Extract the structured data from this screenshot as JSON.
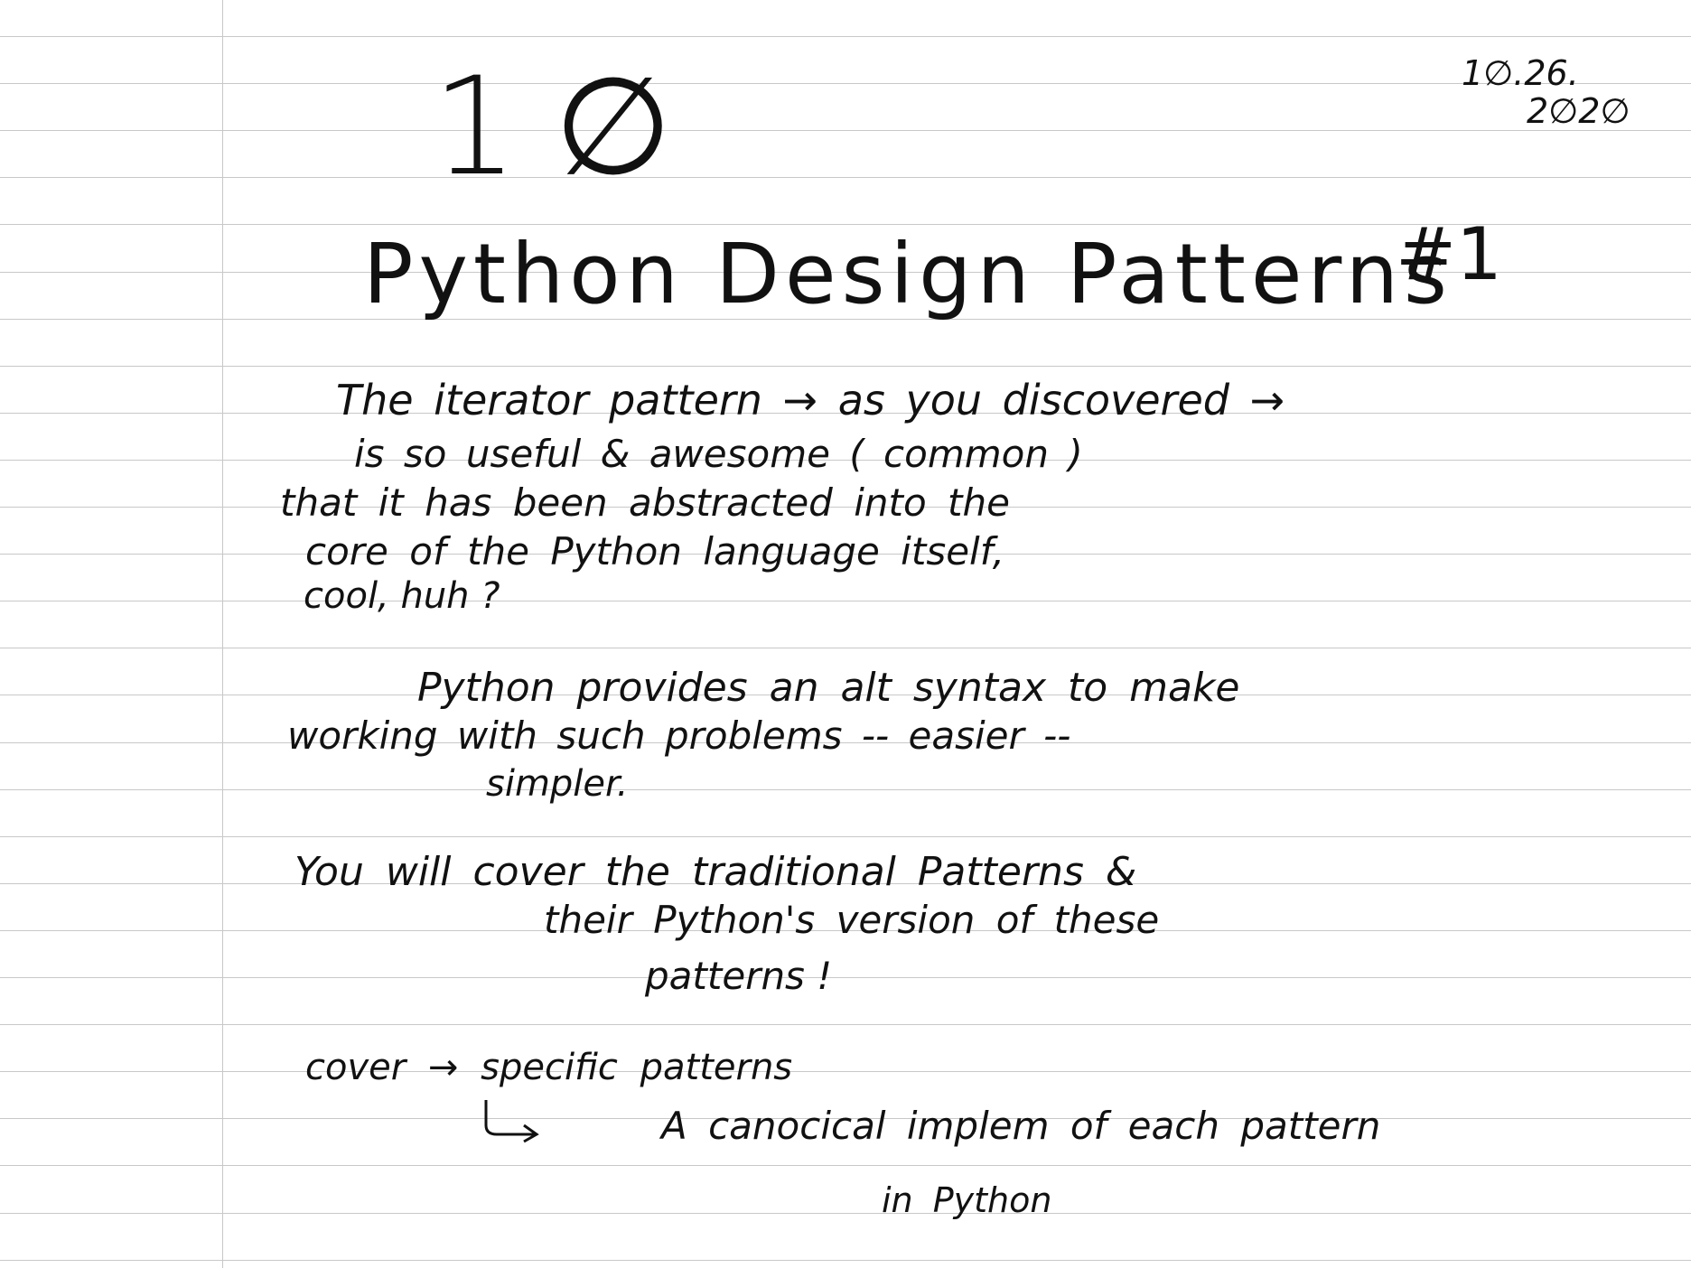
{
  "note": {
    "page_number": "1∅",
    "date_line1": "1∅.26.",
    "date_line2": "2∅2∅",
    "title": "Python Design Patterns",
    "title_badge": "#1",
    "lines": [
      "The   iterator pattern →   as you discovered →",
      "is  so   useful  &   awesome   ( common )",
      "that   it   has  been   abstracted    into   the",
      "core   of    the   Python  language   itself,",
      "cool, huh ?",
      "Python  provides   an   alt   syntax   to  make",
      "working    with    such    problems    -- easier --",
      "simpler.",
      "You   will  cover    the   traditional   Patterns  &",
      "their    Python's   version  of   these",
      "patterns !",
      "cover  →   specific   patterns",
      "A    canocical    implem   of  each  pattern",
      "in   Python"
    ]
  }
}
